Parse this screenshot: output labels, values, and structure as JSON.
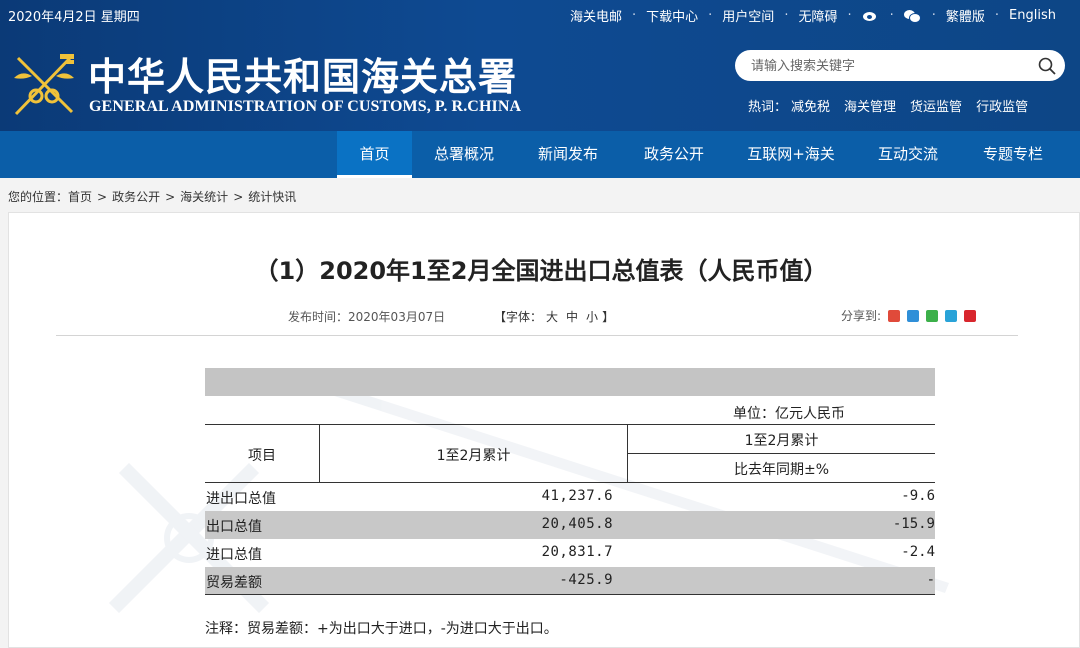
{
  "header": {
    "date": "2020年4月2日 星期四",
    "top_links": [
      "海关电邮",
      "下载中心",
      "用户空间",
      "无障碍"
    ],
    "lang_links": [
      "繁體版",
      "English"
    ],
    "title_cn": "中华人民共和国海关总署",
    "title_en": "GENERAL ADMINISTRATION OF CUSTOMS, P. R.CHINA",
    "search_placeholder": "请输入搜索关键字",
    "hot_label": "热词：",
    "hot_words": [
      "减免税",
      "海关管理",
      "货运监管",
      "行政监管"
    ],
    "icons": [
      "weibo-icon",
      "wechat-icon",
      "search-icon",
      "customs-emblem"
    ],
    "colors": {
      "header_bg": "#0e4a92",
      "nav_bg": "#0b5ea8",
      "nav_active": "#0a72c4"
    }
  },
  "nav": {
    "items": [
      "首页",
      "总署概况",
      "新闻发布",
      "政务公开",
      "互联网+海关",
      "互动交流",
      "专题专栏"
    ],
    "active": "首页"
  },
  "breadcrumb": {
    "label": "您的位置：",
    "items": [
      "首页",
      "政务公开",
      "海关统计",
      "统计快讯"
    ],
    "separator": ">"
  },
  "article": {
    "title": "（1）2020年1至2月全国进出口总值表（人民币值）",
    "publish_label": "发布时间：",
    "publish_date": "2020年03月07日",
    "font_label": "【字体：",
    "font_sizes": [
      "大",
      "中",
      "小"
    ],
    "font_close": "】",
    "share_label": "分享到:",
    "share_colors": [
      "#e04a3a",
      "#2f8fd8",
      "#3cb04a",
      "#29a3d8",
      "#d8262d"
    ]
  },
  "table": {
    "unit": "单位：亿元人民币",
    "header_item": "项目",
    "header_col1": "1至2月累计",
    "header_col2_top": "1至2月累计",
    "header_col2_bottom": "比去年同期±%",
    "rows": [
      {
        "name": "进出口总值",
        "v1": "41,237.6",
        "v2": "-9.6"
      },
      {
        "name": "出口总值",
        "v1": "20,405.8",
        "v2": "-15.9"
      },
      {
        "name": "进口总值",
        "v1": "20,831.7",
        "v2": "-2.4"
      },
      {
        "name": "贸易差额",
        "v1": "-425.9",
        "v2": "-"
      }
    ],
    "note": "注释：贸易差额：+为出口大于进口，-为进口大于出口。"
  }
}
